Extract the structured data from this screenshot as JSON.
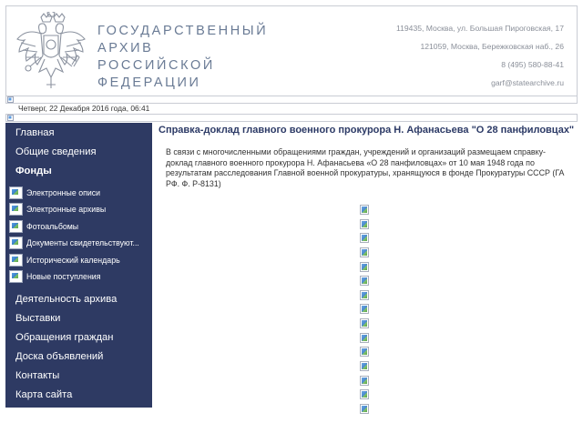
{
  "header": {
    "title_lines": [
      "ГОСУДАРСТВЕННЫЙ",
      "АРХИВ",
      "РОССИЙСКОЙ",
      "ФЕДЕРАЦИИ"
    ],
    "contacts": [
      "119435, Москва, ул. Большая Пироговская, 17",
      "121059, Москва, Бережковская наб., 26",
      "8 (495) 580-88-41",
      "garf@statearchive.ru"
    ],
    "emblem_icon": "double-headed-eagle-icon"
  },
  "datebar": {
    "date": "Четверг, 22 Декабря 2016 года,  06:41"
  },
  "sidebar": {
    "top_items": [
      "Главная",
      "Общие сведения",
      "Фонды"
    ],
    "sub_items": [
      "Электронные описи",
      "Электронные архивы",
      "Фотоальбомы",
      "Документы свидетельствуют...",
      "Исторический календарь",
      "Новые поступления"
    ],
    "bottom_items": [
      "Деятельность архива",
      "Выставки",
      "Обращения граждан",
      "Доска объявлений",
      "Контакты",
      "Карта сайта"
    ]
  },
  "main": {
    "title": "Справка-доклад главного военного прокурора Н. Афанасьева \"О 28 панфиловцах\"",
    "text": "В связи с многочисленными обращениями граждан, учреждений и организаций размещаем справку-доклад главного военного прокурора Н. Афанасьева «О 28 панфиловцах» от 10 мая 1948 года по результатам расследования Главной военной прокуратуры, хранящуюся в фонде Прокуратуры СССР (ГА РФ. Ф. Р-8131)",
    "image_count": 15
  },
  "colors": {
    "sidebar_bg": "#2e3a63",
    "title_color": "#6a7b95",
    "heading_color": "#2c3a66"
  }
}
